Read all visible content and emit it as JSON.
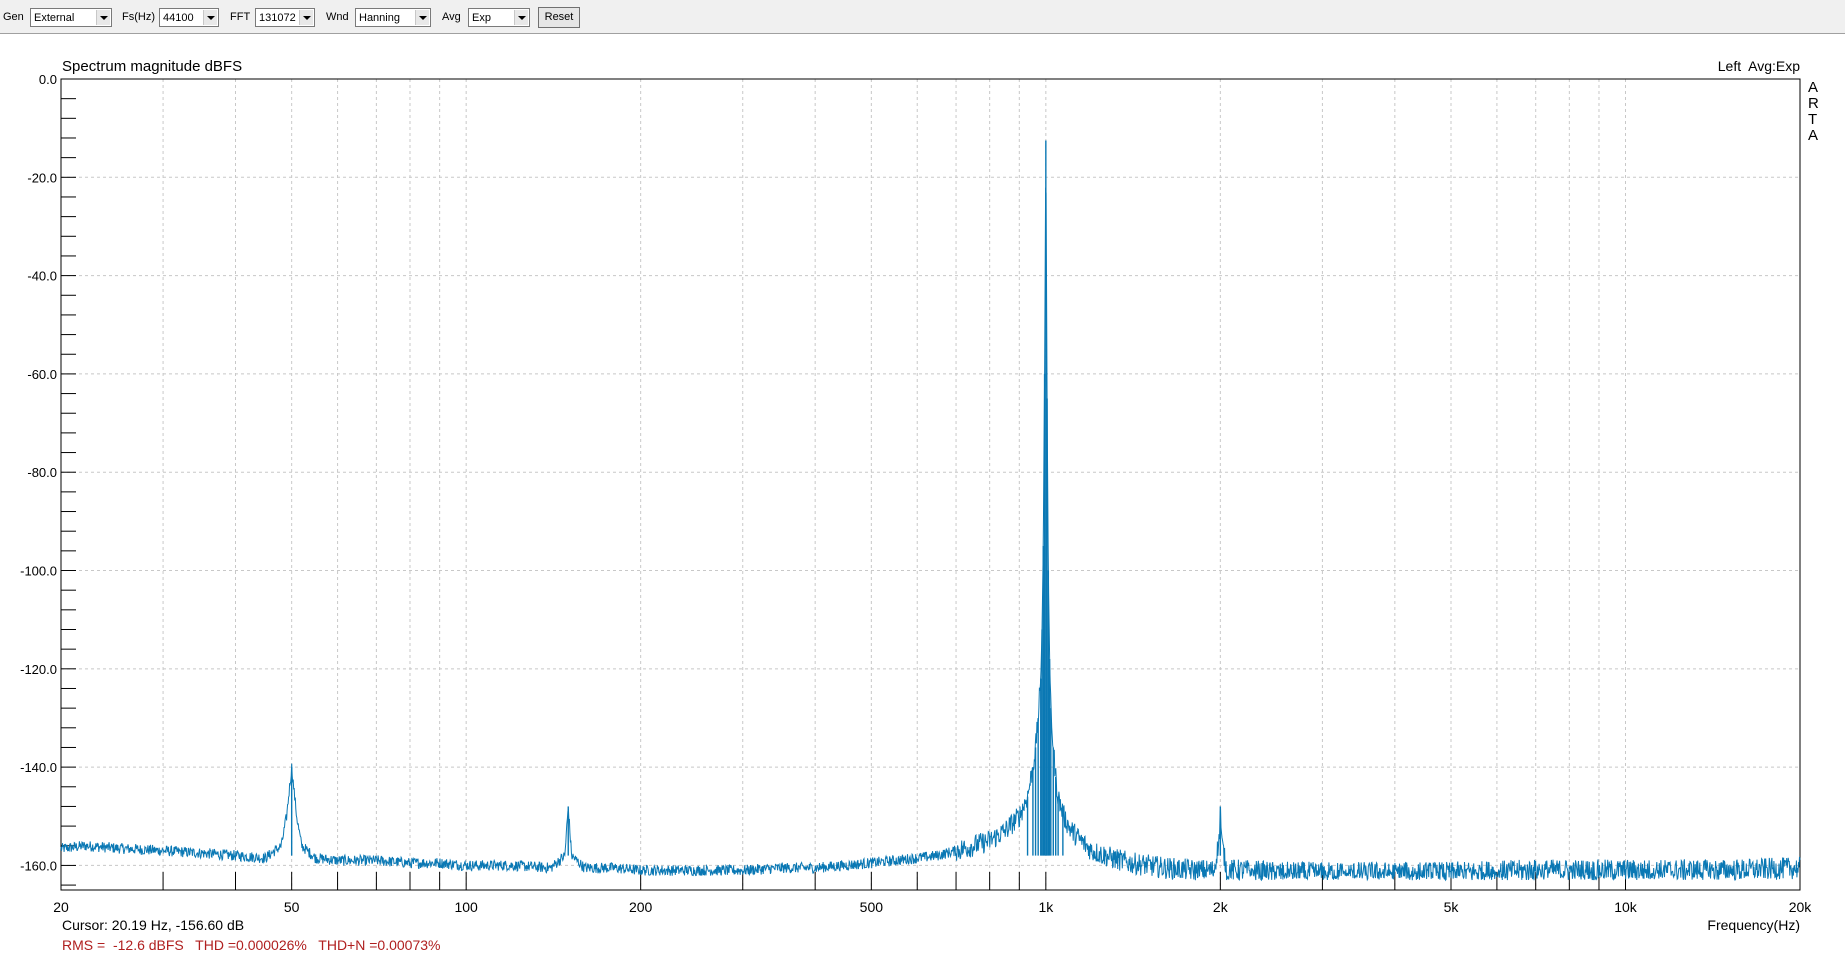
{
  "toolbar": {
    "gen_label": "Gen",
    "gen_value": "External",
    "fs_label": "Fs(Hz)",
    "fs_value": "44100",
    "fft_label": "FFT",
    "fft_value": "131072",
    "wnd_label": "Wnd",
    "wnd_value": "Hanning",
    "avg_label": "Avg",
    "avg_value": "Exp",
    "reset_label": "Reset"
  },
  "plot": {
    "title": "Spectrum magnitude dBFS",
    "channel": "Left  Avg:Exp",
    "arta_letters": [
      "A",
      "R",
      "T",
      "A"
    ],
    "x_axis_label": "Frequency(Hz)"
  },
  "status": {
    "cursor": "Cursor: 20.19 Hz, -156.60 dB",
    "measurements": "RMS =  -12.6 dBFS   THD =0.000026%   THD+N =0.00073%"
  },
  "colors": {
    "trace": "#0a78b4",
    "grid": "#c8c8c8",
    "measurements_text": "#b02020"
  },
  "chart_data": {
    "type": "line",
    "title": "Spectrum magnitude dBFS",
    "xlabel": "Frequency(Hz)",
    "ylabel": "",
    "x_scale": "log",
    "xlim": [
      20,
      20000
    ],
    "ylim": [
      -165,
      0
    ],
    "grid": true,
    "x_ticks": [
      20,
      50,
      100,
      200,
      500,
      1000,
      2000,
      5000,
      10000,
      20000
    ],
    "x_tick_labels": [
      "20",
      "50",
      "100",
      "200",
      "500",
      "1k",
      "2k",
      "5k",
      "10k",
      "20k"
    ],
    "y_ticks": [
      0,
      -20,
      -40,
      -60,
      -80,
      -100,
      -120,
      -140,
      -160
    ],
    "y_tick_labels": [
      "0.0",
      "-20.0",
      "-40.0",
      "-60.0",
      "-80.0",
      "-100.0",
      "-120.0",
      "-140.0",
      "-160.0"
    ],
    "series": [
      {
        "x": [
          20,
          22,
          25,
          30,
          35,
          40,
          45,
          48,
          49,
          50,
          51,
          52,
          55,
          60,
          70,
          80,
          90,
          100,
          120,
          140,
          148,
          150,
          152,
          160,
          180,
          200,
          250,
          300,
          350,
          400,
          450,
          500,
          550,
          600,
          650,
          700,
          750,
          800,
          850,
          900,
          930,
          950,
          960,
          970,
          980,
          985,
          990,
          995,
          1000,
          1005,
          1010,
          1015,
          1020,
          1030,
          1040,
          1050,
          1070,
          1100,
          1150,
          1200,
          1300,
          1400,
          1500,
          1600,
          1800,
          1950,
          1990,
          2000,
          2010,
          2050,
          2200,
          2500,
          3000,
          4000,
          5000,
          7000,
          10000,
          15000,
          20000
        ],
        "y": [
          -156.6,
          -156,
          -156.5,
          -157,
          -157.5,
          -158,
          -158.5,
          -156,
          -150,
          -140,
          -150,
          -156,
          -158.5,
          -159,
          -159,
          -159.5,
          -159.5,
          -160,
          -160,
          -160.5,
          -158,
          -148,
          -158,
          -160.5,
          -160.5,
          -161,
          -161,
          -161,
          -160.5,
          -160.5,
          -160,
          -159.5,
          -159,
          -158.5,
          -158,
          -157,
          -156,
          -155,
          -153,
          -150,
          -146,
          -140,
          -136,
          -130,
          -122,
          -112,
          -95,
          -60,
          -12.5,
          -65,
          -100,
          -118,
          -128,
          -136,
          -142,
          -146,
          -149.5,
          -152.5,
          -155,
          -157,
          -158.5,
          -159.5,
          -160,
          -160.5,
          -161,
          -161,
          -155,
          -148,
          -155,
          -161,
          -161,
          -161.5,
          -161.5,
          -161.5,
          -161.5,
          -161,
          -161,
          -161,
          -160.5
        ]
      }
    ]
  }
}
